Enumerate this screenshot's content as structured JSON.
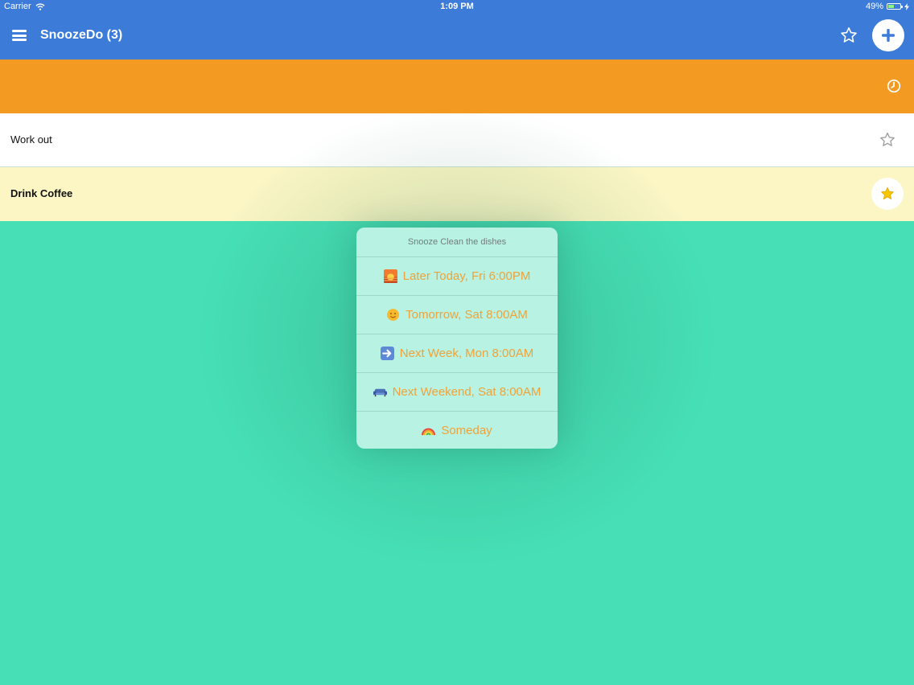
{
  "status": {
    "carrier": "Carrier",
    "time": "1:09 PM",
    "battery": "49%",
    "battery_level": 0.49
  },
  "nav": {
    "title": "SnoozeDo (3)",
    "star_icon": "star-outline-icon",
    "add_icon": "plus-icon"
  },
  "tasks": [
    {
      "label": "",
      "icon": "clock-icon",
      "color": "#f29a21"
    },
    {
      "label": "Work out",
      "icon": "star-outline-icon",
      "color": "#ffffff"
    },
    {
      "label": "Drink Coffee",
      "icon": "star-filled-icon",
      "color": "#fbf6c4"
    }
  ],
  "snooze_menu": {
    "title": "Snooze Clean the dishes",
    "options": [
      {
        "label": "Later Today, Fri 6:00PM",
        "icon": "sunset-icon"
      },
      {
        "label": "Tomorrow, Sat 8:00AM",
        "icon": "sun-face-icon"
      },
      {
        "label": "Next Week, Mon 8:00AM",
        "icon": "right-arrow-icon"
      },
      {
        "label": "Next Weekend, Sat 8:00AM",
        "icon": "couch-icon"
      },
      {
        "label": "Someday",
        "icon": "rainbow-icon"
      }
    ]
  },
  "colors": {
    "nav": "#3d7bd9",
    "background": "#47e0b6",
    "accent": "#f0a23a",
    "star": "#f7c600"
  }
}
